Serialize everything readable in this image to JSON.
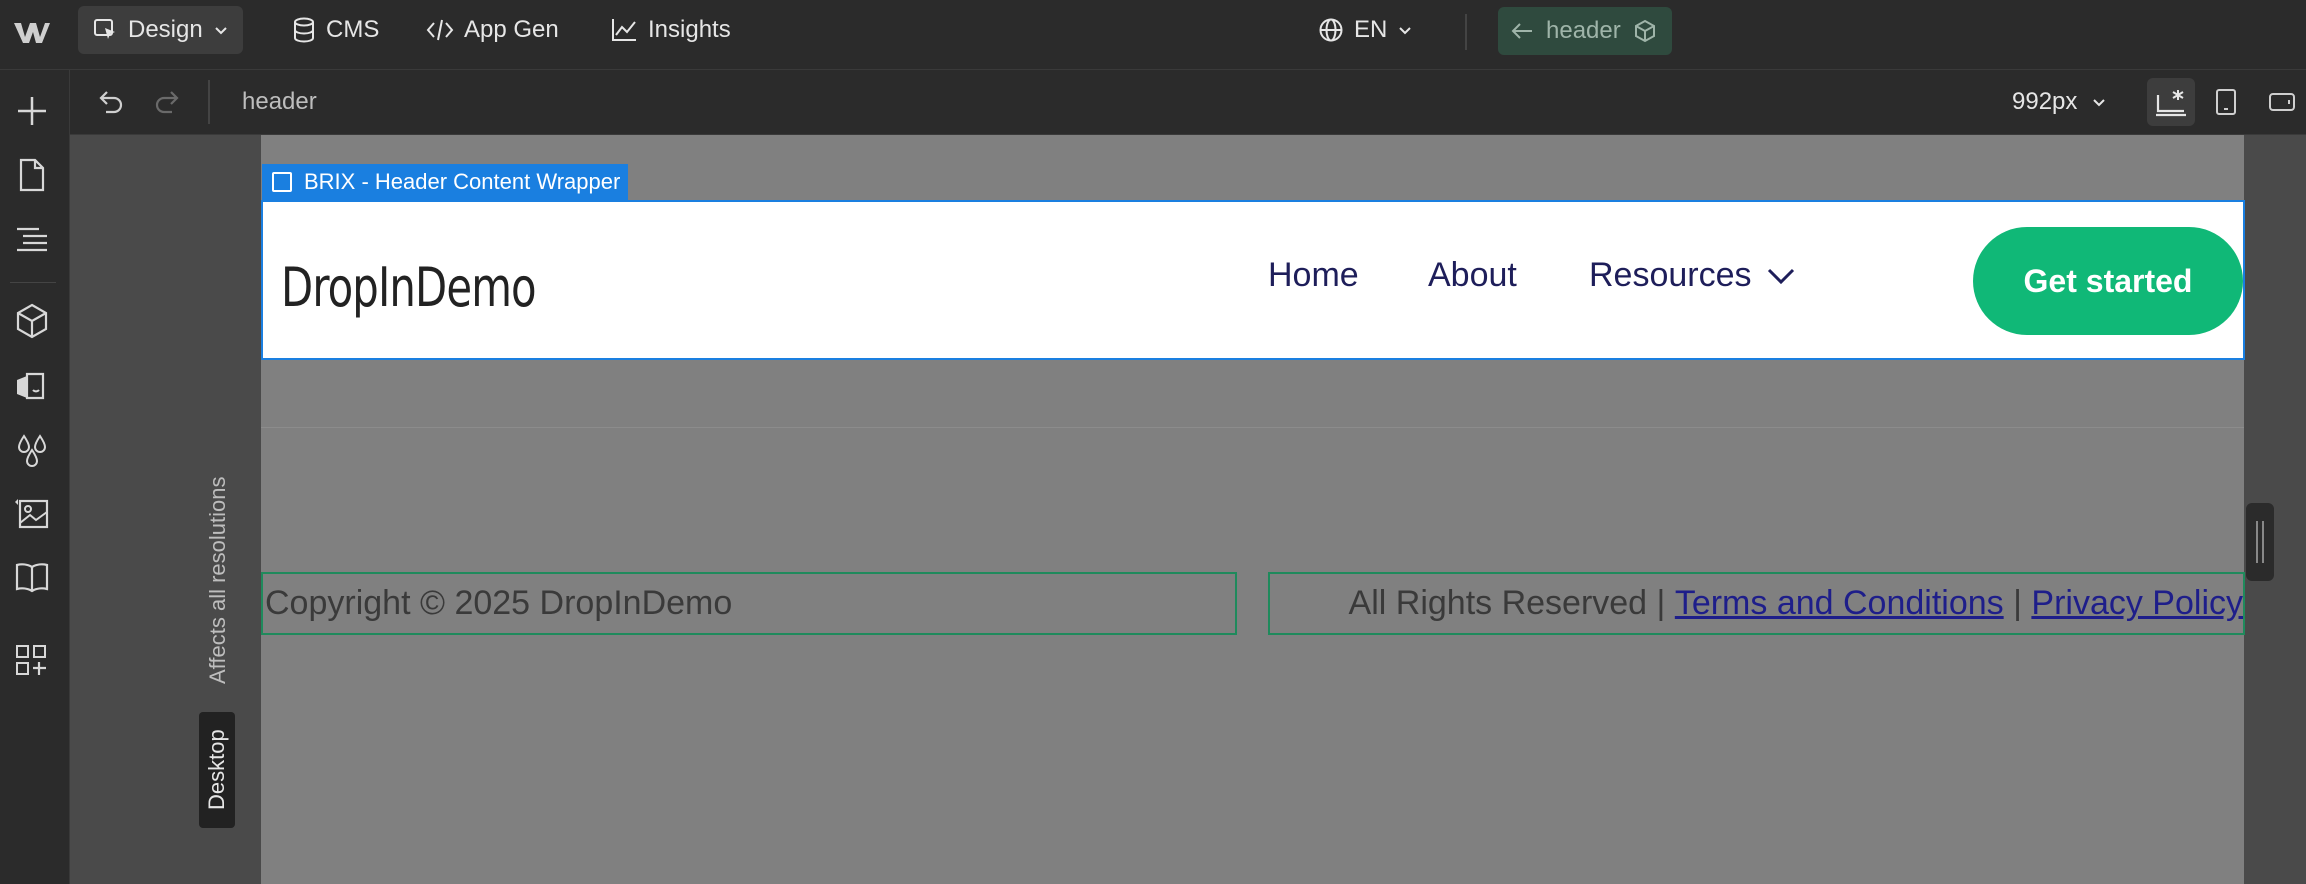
{
  "topbar": {
    "design_label": "Design",
    "cms_label": "CMS",
    "appgen_label": "App Gen",
    "insights_label": "Insights",
    "locale_label": "EN",
    "component_label": "header"
  },
  "toolbar": {
    "breadcrumb": "header",
    "breakpoint_size": "992px"
  },
  "canvas": {
    "selection_label": "BRIX - Header Content Wrapper",
    "breakpoint_note": "Affects all resolutions",
    "breakpoint_tab": "Desktop"
  },
  "site": {
    "brand": "DropInDemo",
    "nav": [
      "Home",
      "About",
      "Resources"
    ],
    "cta": "Get started",
    "footer_copyright": "Copyright © 2025 DropInDemo",
    "footer_rights": "All Rights Reserved | ",
    "footer_terms": "Terms and Conditions",
    "footer_sep": " | ",
    "footer_privacy": "Privacy Policy"
  },
  "colors": {
    "selection_blue": "#1a7fe0",
    "cta_green": "#10b877",
    "chip_green": "#2f4a3e"
  }
}
